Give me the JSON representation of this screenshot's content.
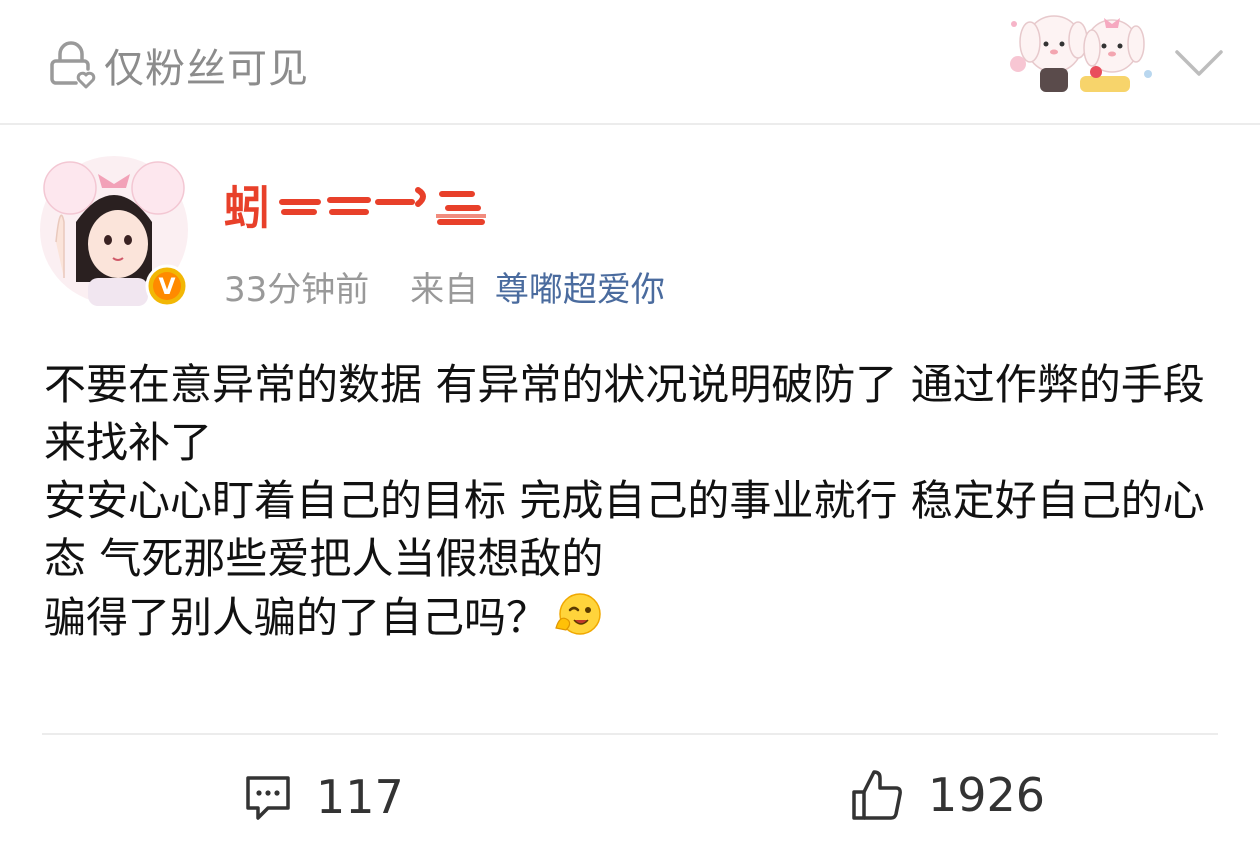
{
  "header": {
    "visibility_label": "仅粉丝可见",
    "visibility_icon": "lock-heart-icon",
    "collapse_icon": "chevron-down-icon"
  },
  "post": {
    "username": "蚓",
    "time": "33分钟前",
    "from_label": "来自",
    "source": "尊嘟超爱你",
    "verified_badge": "V",
    "content": [
      "不要在意异常的数据 有异常的状况说明破防了 通过作弊的手段来找补了",
      "安安心心盯着自己的目标 完成自己的事业就行 稳定好自己的心态 气死那些爱把人当假想敌的",
      "骗得了别人骗的了自己吗？"
    ],
    "emoji": "wink-emoji"
  },
  "actions": {
    "comment_count": "117",
    "like_count": "1926"
  },
  "colors": {
    "source_link": "#4a6b9e",
    "muted_text": "#999999",
    "username_red": "#e8402a",
    "badge_gold": "#f2b705"
  }
}
